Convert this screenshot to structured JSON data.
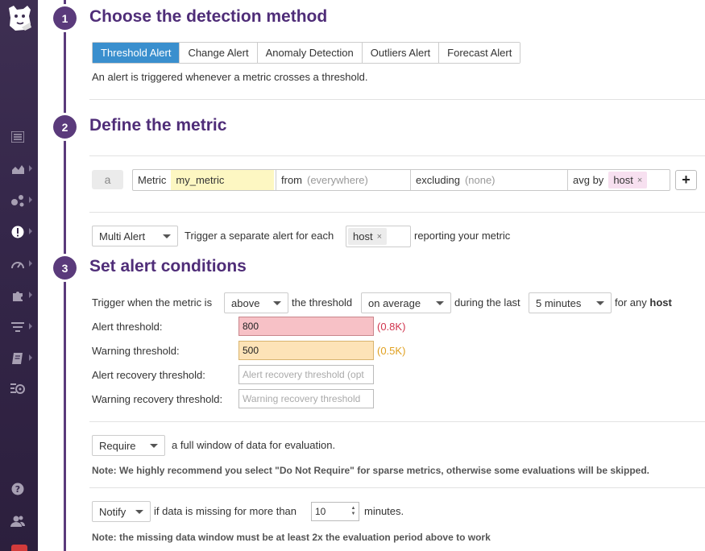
{
  "sidebar": {
    "logo": "datadog-logo",
    "items": [
      {
        "icon": "list-icon"
      },
      {
        "icon": "area-chart-icon"
      },
      {
        "icon": "infrastructure-icon"
      },
      {
        "icon": "alert-icon",
        "active": true
      },
      {
        "icon": "gauge-icon"
      },
      {
        "icon": "puzzle-icon"
      },
      {
        "icon": "filter-list-icon"
      },
      {
        "icon": "notebook-icon"
      },
      {
        "icon": "watchdog-icon"
      }
    ],
    "bottom": [
      {
        "icon": "help-icon"
      },
      {
        "icon": "users-icon"
      }
    ]
  },
  "steps": [
    {
      "num": "1",
      "title": "Choose the detection method"
    },
    {
      "num": "2",
      "title": "Define the metric"
    },
    {
      "num": "3",
      "title": "Set alert conditions"
    }
  ],
  "detection": {
    "tabs": [
      "Threshold Alert",
      "Change Alert",
      "Anomaly Detection",
      "Outliers Alert",
      "Forecast Alert"
    ],
    "active_tab": "Threshold Alert",
    "description": "An alert is triggered whenever a metric crosses a threshold."
  },
  "metric": {
    "letter": "a",
    "metric_label": "Metric",
    "metric_value": "my_metric",
    "from_label": "from",
    "from_value": "(everywhere)",
    "excluding_label": "excluding",
    "excluding_value": "(none)",
    "avg_label": "avg by",
    "avg_tag": "host",
    "tag_close": "×",
    "add_label": "+"
  },
  "multi_alert": {
    "select": "Multi Alert",
    "text_before": "Trigger a separate alert for each",
    "tag": "host",
    "tag_close": "×",
    "text_after": "reporting your metric"
  },
  "conditions": {
    "trigger_text": "Trigger when the metric is",
    "comparator": "above",
    "threshold_text": "the threshold",
    "aggregation": "on average",
    "during_text": "during the last",
    "window": "5 minutes",
    "for_any_text": "for any",
    "for_any_value": "host",
    "alert_threshold_label": "Alert threshold:",
    "alert_threshold_value": "800",
    "alert_threshold_hint": "(0.8K)",
    "warning_threshold_label": "Warning threshold:",
    "warning_threshold_value": "500",
    "warning_threshold_hint": "(0.5K)",
    "alert_recovery_label": "Alert recovery threshold:",
    "alert_recovery_placeholder": "Alert recovery threshold (opt",
    "warning_recovery_label": "Warning recovery threshold:",
    "warning_recovery_placeholder": "Warning recovery threshold",
    "require_select": "Require",
    "require_text": "a full window of data for evaluation.",
    "require_note": "Note: We highly recommend you select \"Do Not Require\" for sparse metrics, otherwise some evaluations will be skipped.",
    "notify_select": "Notify",
    "notify_text": "if data is missing for more than",
    "notify_minutes": "10",
    "minutes_text": "minutes.",
    "notify_note": "Note: the missing data window must be at least 2x the evaluation period above to work"
  },
  "colors": {
    "accent": "#3a8fce",
    "step": "#5a3a7b",
    "title": "#4f2d78",
    "alert_text": "#d0344d",
    "warn_text": "#e0a020"
  }
}
